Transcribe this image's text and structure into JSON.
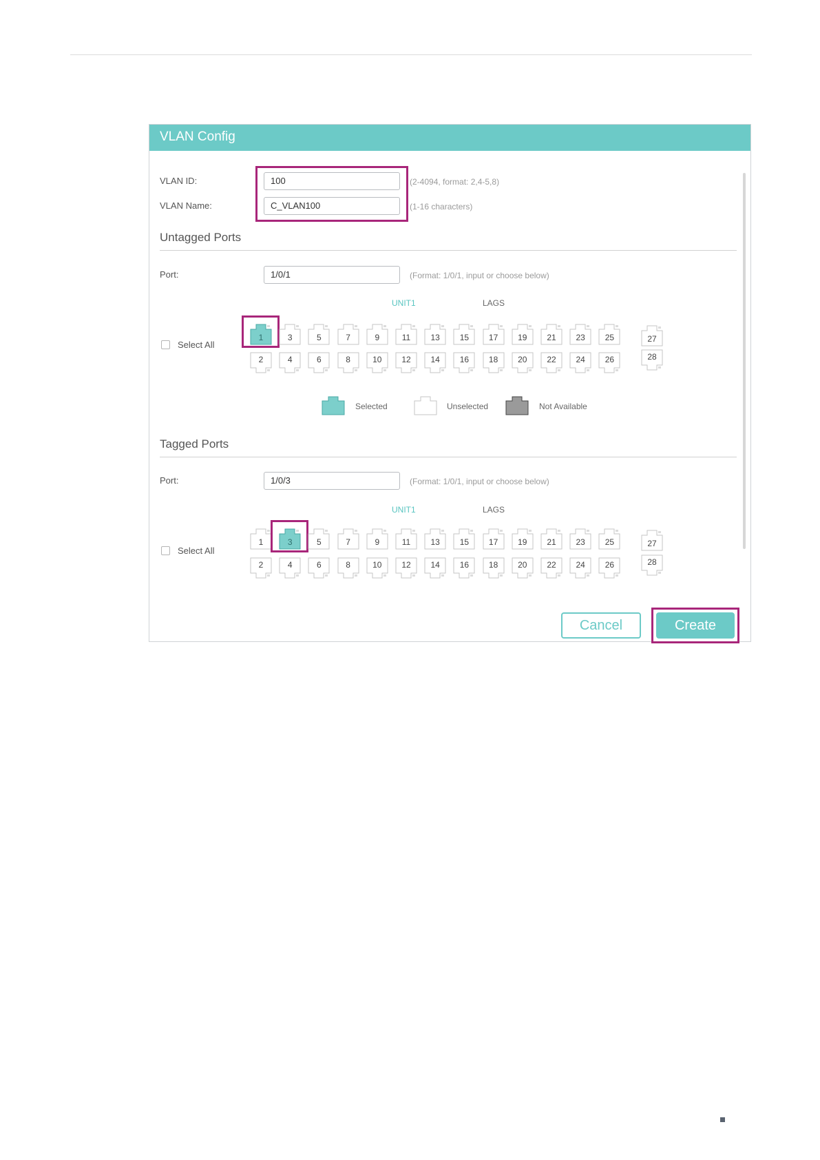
{
  "dialog": {
    "title": "VLAN Config"
  },
  "vlan_id": {
    "label": "VLAN ID:",
    "value": "100",
    "hint": "(2-4094, format: 2,4-5,8)"
  },
  "vlan_name": {
    "label": "VLAN Name:",
    "value": "C_VLAN100",
    "hint": "(1-16 characters)"
  },
  "untagged": {
    "title": "Untagged Ports",
    "port_label": "Port:",
    "port_value": "1/0/1",
    "port_hint": "(Format: 1/0/1, input or choose below)",
    "tab_unit": "UNIT1",
    "tab_lags": "LAGS",
    "select_all": "Select All",
    "selected_ports": [
      "1"
    ]
  },
  "legend": {
    "selected": "Selected",
    "unselected": "Unselected",
    "not_available": "Not Available"
  },
  "tagged": {
    "title": "Tagged Ports",
    "port_label": "Port:",
    "port_value": "1/0/3",
    "port_hint": "(Format: 1/0/1, input or choose below)",
    "tab_unit": "UNIT1",
    "tab_lags": "LAGS",
    "select_all": "Select All",
    "selected_ports": [
      "3"
    ]
  },
  "ports": {
    "top_row": [
      "1",
      "3",
      "5",
      "7",
      "9",
      "11",
      "13",
      "15",
      "17",
      "19",
      "21",
      "23",
      "25"
    ],
    "bottom_row": [
      "2",
      "4",
      "6",
      "8",
      "10",
      "12",
      "14",
      "16",
      "18",
      "20",
      "22",
      "24",
      "26"
    ],
    "sfp_top": "27",
    "sfp_bottom": "28"
  },
  "buttons": {
    "cancel": "Cancel",
    "create": "Create"
  },
  "colors": {
    "accent": "#6ccac7",
    "highlight": "#a8267a",
    "not_available": "#9a9a9a",
    "port_selected": "#7ccfcb"
  }
}
